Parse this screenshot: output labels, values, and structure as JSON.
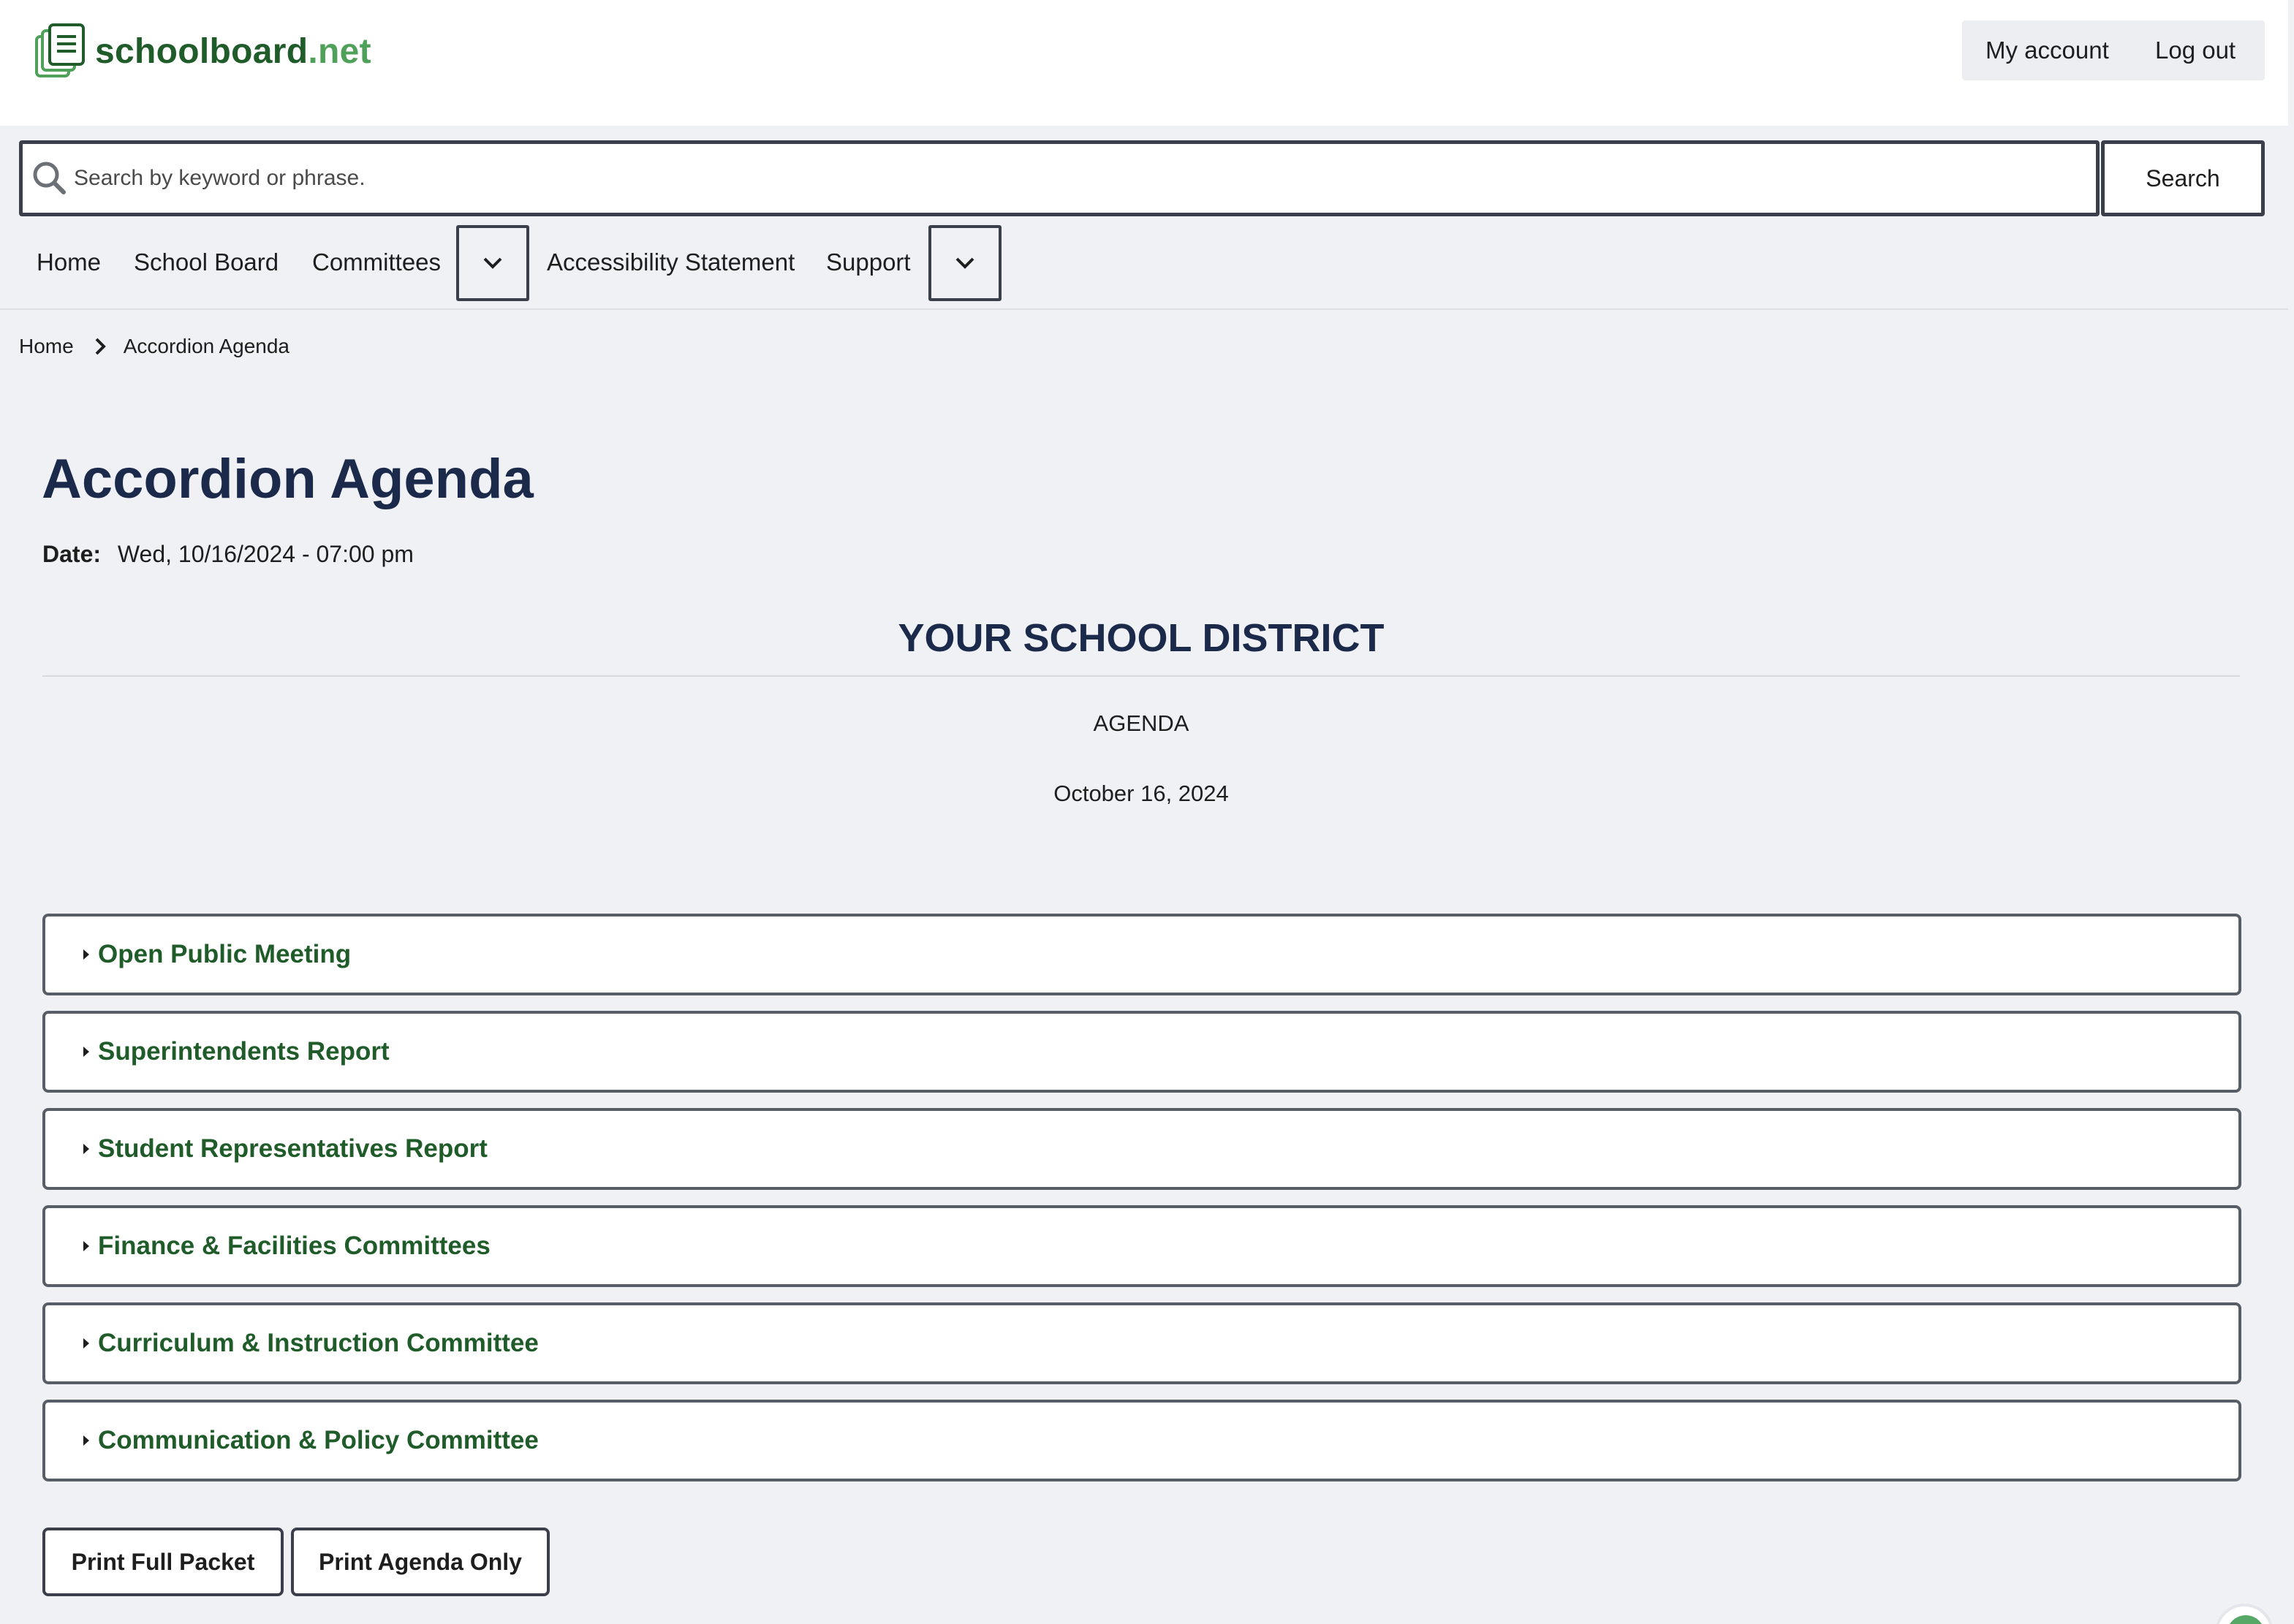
{
  "brand": {
    "name": "schoolboard",
    "tld": ".net",
    "logo_icon": "document-stack-icon",
    "primary_color": "#1f5c2a",
    "accent_color": "#4fa15a"
  },
  "account": {
    "my_account": "My account",
    "log_out": "Log out"
  },
  "search": {
    "placeholder": "Search by keyword or phrase.",
    "value": "",
    "button_label": "Search"
  },
  "nav": {
    "home": "Home",
    "school_board": "School Board",
    "committees": "Committees",
    "accessibility": "Accessibility Statement",
    "support": "Support"
  },
  "breadcrumb": {
    "home": "Home",
    "current": "Accordion Agenda"
  },
  "page": {
    "title": "Accordion Agenda",
    "date_label": "Date:",
    "date_value": "Wed, 10/16/2024 - 07:00 pm",
    "district": "YOUR SCHOOL DISTRICT",
    "agenda_label": "AGENDA",
    "agenda_date": "October 16, 2024"
  },
  "accordion_items": [
    "Open Public Meeting",
    "Superintendents Report",
    "Student Representatives Report",
    "Finance & Facilities Committees",
    "Curriculum & Instruction Committee",
    "Communication & Policy Committee"
  ],
  "actions": {
    "print_full": "Print Full Packet",
    "print_agenda": "Print Agenda Only"
  }
}
